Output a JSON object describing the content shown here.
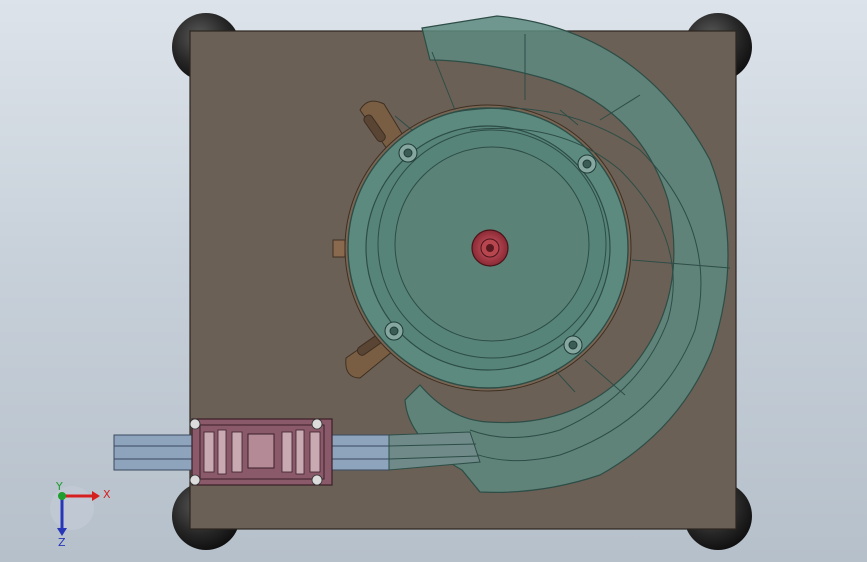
{
  "viewport": {
    "background_top": "#dde3ea",
    "background_bottom": "#b6c0ca"
  },
  "model": {
    "base_plate_color": "#6b6055",
    "bowl_color": "#5d8a7f",
    "bowl_edge_color": "#2d4d47",
    "hub_color": "#a23a43",
    "bracket_color": "#8a6a4e",
    "feeder_color": "#8a5a6a",
    "rail_color": "#8ea3bc",
    "foot_color": "#1f1f1f"
  },
  "triad": {
    "x_label": "X",
    "y_label": "Y",
    "z_label": "Z",
    "x_color": "#d62020",
    "y_color": "#1f9d2e",
    "z_color": "#2636b8",
    "icons": [
      "axis-x-arrow-icon",
      "axis-y-arrow-icon",
      "axis-z-arrow-icon"
    ]
  }
}
